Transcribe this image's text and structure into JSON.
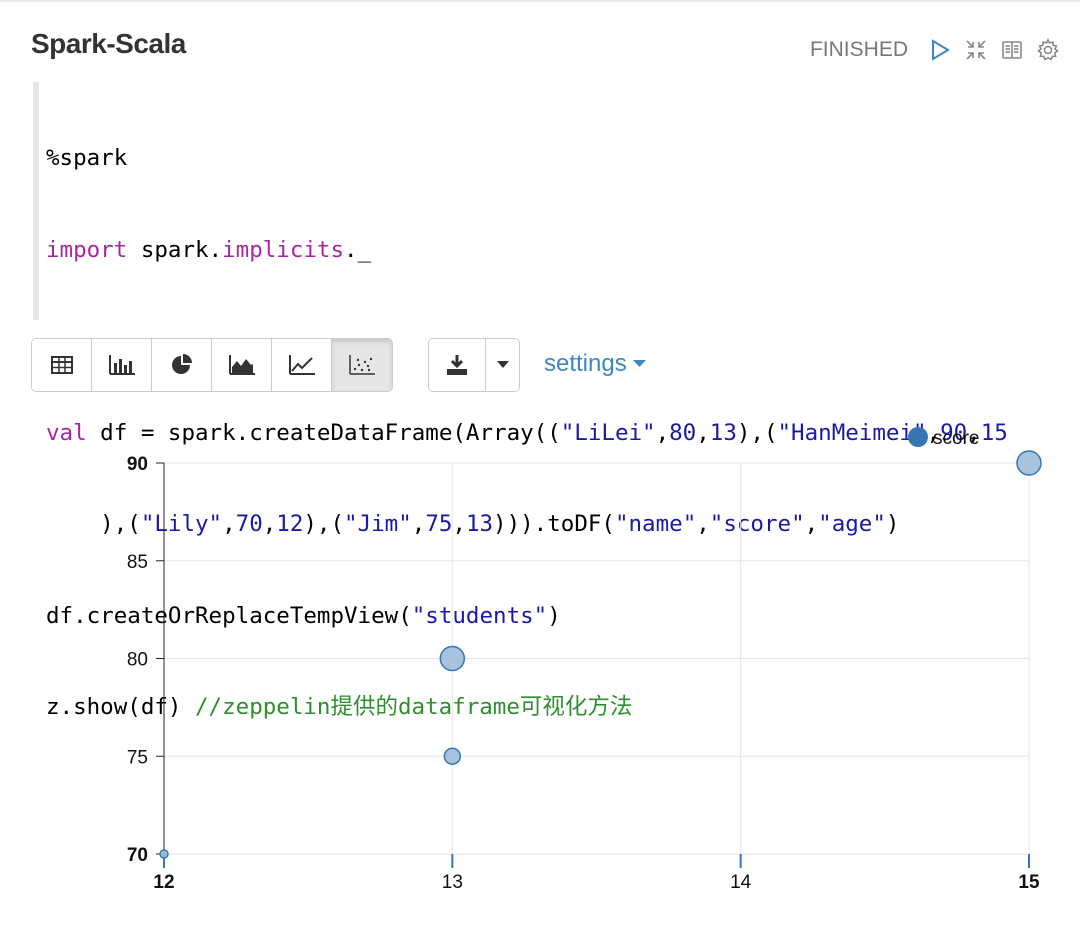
{
  "paragraph": {
    "title": "Spark-Scala",
    "status": "FINISHED",
    "icons": [
      "play-icon",
      "collapse-icon",
      "book-icon",
      "gear-icon"
    ]
  },
  "code": {
    "line1": "%spark",
    "line2_kw": "import",
    "line2_rest": " spark.",
    "line2_kw2": "implicits",
    "line2_end": "._",
    "line4": "val df = spark.createDataFrame(Array((\"LiLei\",80,13),(\"HanMeimei\",90,15",
    "line5": "    ),(\"Lily\",70,12),(\"Jim\",75,13))).toDF(\"name\",\"score\",\"age\")",
    "line6": "df.createOrReplaceTempView(\"students\")",
    "line7_code": "z.show(df) ",
    "line7_comment": "//zeppelin提供的dataframe可视化方法"
  },
  "toolbar": {
    "buttons": [
      "table-icon",
      "bar-chart-icon",
      "pie-chart-icon",
      "area-chart-icon",
      "line-chart-icon",
      "scatter-chart-icon"
    ],
    "active": "scatter-chart-icon",
    "settings_label": "settings"
  },
  "colors": {
    "accent": "#3f86c4",
    "point_fill": "#9dbcda",
    "point_stroke": "#3876b3",
    "comment": "#2f8f2f",
    "keyword": "#a626a4",
    "string": "#1a1aa6"
  },
  "chart_data": {
    "type": "scatter",
    "legend": [
      "score"
    ],
    "legend_position": "top-right",
    "x": [
      13,
      15,
      12,
      13
    ],
    "series": [
      {
        "name": "score",
        "values": [
          80,
          90,
          70,
          75
        ]
      }
    ],
    "bubble_size": [
      1,
      1,
      0,
      0
    ],
    "xlim": [
      12,
      15
    ],
    "ylim": [
      70,
      90
    ],
    "x_ticks": [
      "12",
      "13",
      "14",
      "15"
    ],
    "y_ticks": [
      "90",
      "85",
      "80",
      "75",
      "70"
    ],
    "grid": true
  }
}
